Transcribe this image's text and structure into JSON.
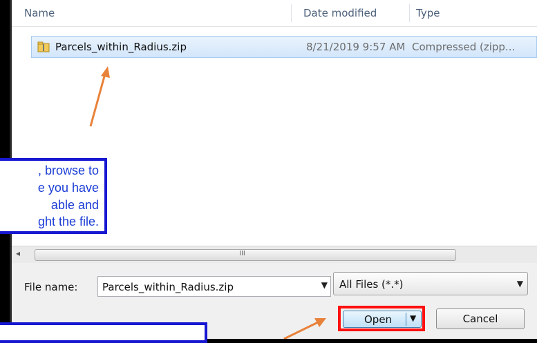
{
  "file_list": {
    "columns": {
      "name": "Name",
      "date": "Date modified",
      "type": "Type"
    },
    "rows": [
      {
        "name": "Parcels_within_Radius.zip",
        "date": "8/21/2019 9:57 AM",
        "type": "Compressed (zipp..."
      }
    ]
  },
  "scrollbar": {
    "left_arrow": "◂",
    "grip": "III"
  },
  "bottom": {
    "file_name_label": "File name:",
    "file_name_value": "Parcels_within_Radius.zip",
    "file_type_value": "All Files (*.*)",
    "open_label": "Open",
    "cancel_label": "Cancel"
  },
  "callout": {
    "lines": [
      ", browse to",
      "e you have",
      "able and",
      "ght the file."
    ]
  },
  "colors": {
    "callout_border": "#1717d2",
    "callout_text": "#1a3cd6",
    "highlight_box": "#ff1010",
    "arrow": "#e8823a"
  },
  "icons": {
    "zip_file": "zip-file-icon",
    "dropdown": "chevron-down-icon"
  }
}
